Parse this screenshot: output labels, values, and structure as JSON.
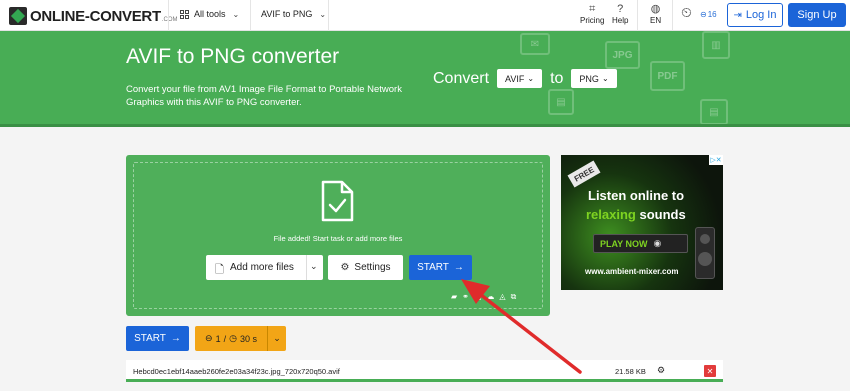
{
  "nav": {
    "logo_text": "ONLINE-CONVERT",
    "logo_suffix": ".COM",
    "all_tools": "All tools",
    "converter_menu": "AVIF to PNG",
    "pricing": "Pricing",
    "help": "Help",
    "language": "EN",
    "credits": "16",
    "login": "Log In",
    "signup": "Sign Up"
  },
  "hero": {
    "title": "AVIF to PNG converter",
    "subtitle": "Convert your file from AV1 Image File Format to Portable Network Graphics with this AVIF to PNG converter.",
    "convert_label": "Convert",
    "from_format": "AVIF",
    "to_label": "to",
    "to_format": "PNG",
    "deco_labels": [
      "JPG",
      "PDF"
    ]
  },
  "uploader": {
    "status_text": "File added! Start task or add more files",
    "add_more_label": "Add more files",
    "settings_label": "Settings",
    "start_label": "START"
  },
  "ad": {
    "tag": "FREE",
    "line1": "Listen online to",
    "line2_accent": "relaxing",
    "line2_rest": "sounds",
    "play_label": "PLAY NOW",
    "url": "www.ambient-mixer.com"
  },
  "queue": {
    "start_label": "START",
    "count": "1",
    "time": "30 s"
  },
  "file": {
    "name": "Hebcd0ec1ebf14aaeb260fe2e03a34f23c.jpg_720x720q50.avif",
    "size": "21.58 KB"
  },
  "colors": {
    "brand_green": "#48ad55",
    "primary_blue": "#1b64d8",
    "queue_orange": "#f2a516",
    "annotation_red": "#e02b2b"
  }
}
